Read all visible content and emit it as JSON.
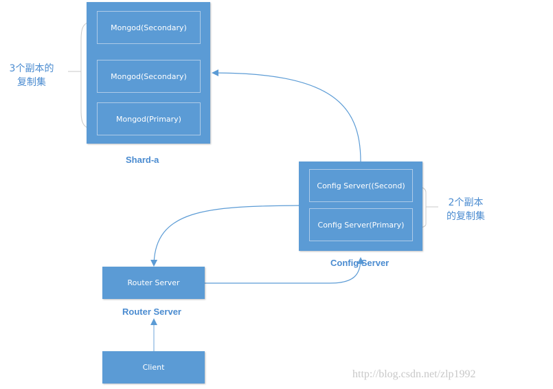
{
  "shard": {
    "label": "Shard-a",
    "members": [
      "Mongod(Secondary)",
      "Mongod(Secondary)",
      "Mongod(Primary)"
    ],
    "annotation_line1": "3个副本的",
    "annotation_line2": "复制集"
  },
  "config": {
    "label": "Config Server",
    "members": [
      "Config Server((Second)",
      "Config Server(Primary)"
    ],
    "annotation_line1": "2个副本",
    "annotation_line2": "的复制集"
  },
  "router": {
    "box_text": "Router Server",
    "label": "Router Server"
  },
  "client": {
    "box_text": "Client"
  },
  "watermark": "http://blog.csdn.net/zlp1992",
  "colors": {
    "box_fill": "#5b9bd5",
    "label_text": "#4a8bd0",
    "connector": "#5b9bd5"
  }
}
